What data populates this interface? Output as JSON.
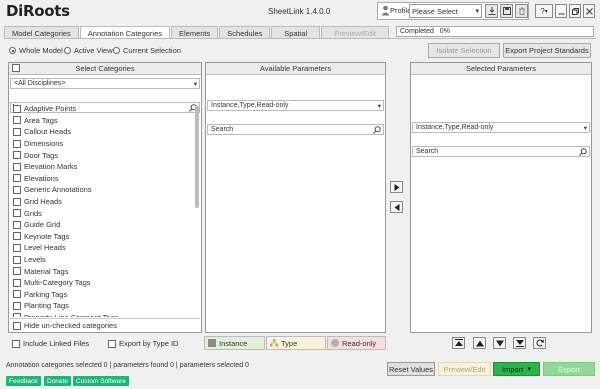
{
  "header": {
    "logo": "DiRoots",
    "title": "SheetLink 1.4.0.0",
    "profile_label": "Profile",
    "profile_value": "Please Select",
    "help_label": "?"
  },
  "tabs": [
    {
      "label": "Model Categories",
      "active": false
    },
    {
      "label": "Annotation Categories",
      "active": true
    },
    {
      "label": "Elements",
      "active": false
    },
    {
      "label": "Schedules",
      "active": false
    },
    {
      "label": "Spatial",
      "active": false
    },
    {
      "label": "Preview/Edit",
      "active": false,
      "disabled": true
    }
  ],
  "progress": {
    "label": "Completed",
    "percent_text": "0%",
    "value": 0
  },
  "scope": {
    "options": [
      "Whole Model",
      "Active View",
      "Current Selection"
    ],
    "selected": "Whole Model"
  },
  "top_buttons": {
    "isolate": "Isolate Selection",
    "export_standards": "Export Project Standards"
  },
  "categories_panel": {
    "title": "Select Categories",
    "discipline": "<All Disciplines>",
    "search_value": "",
    "items": [
      "Adaptive Points",
      "Area Tags",
      "Callout Heads",
      "Dimensions",
      "Door Tags",
      "Elevation Marks",
      "Elevations",
      "Generic Annotations",
      "Grid Heads",
      "Grids",
      "Guide Grid",
      "Keynote Tags",
      "Level Heads",
      "Levels",
      "Material Tags",
      "Multi-Category Tags",
      "Parking Tags",
      "Planting Tags",
      "Property Line Segment Tags"
    ],
    "hide_unchecked": "Hide un-checked categories"
  },
  "available_panel": {
    "title": "Available Parameters",
    "filter": "Instance,Type,Read-only",
    "search_placeholder": "Search"
  },
  "selected_panel": {
    "title": "Selected Parameters",
    "filter": "Instance,Type,Read-only",
    "search_placeholder": "Search"
  },
  "options": {
    "linked_files": "Include Linked Files",
    "export_by_type": "Export by Type ID"
  },
  "legend": [
    {
      "label": "Instance",
      "color": "#8a8a8a",
      "bg": "#e3f0d8"
    },
    {
      "label": "Type",
      "color": "#c8a060",
      "bg": "#faf3dc"
    },
    {
      "label": "Read-only",
      "color": "#b0b0b0",
      "bg": "#f8dede"
    }
  ],
  "status": "Annotation categories selected 0 | parameters found 0 | parameters selected 0",
  "bottom_buttons": {
    "reset": "Reset Values",
    "preview": "Preview/Edit",
    "import": "Import",
    "export": "Export"
  },
  "footer_links": [
    "Feedback",
    "Donate",
    "Custom Software"
  ],
  "colors": {
    "accent_green": "#1eb57a",
    "import_green": "#2db34a",
    "export_green": "#93d896"
  }
}
